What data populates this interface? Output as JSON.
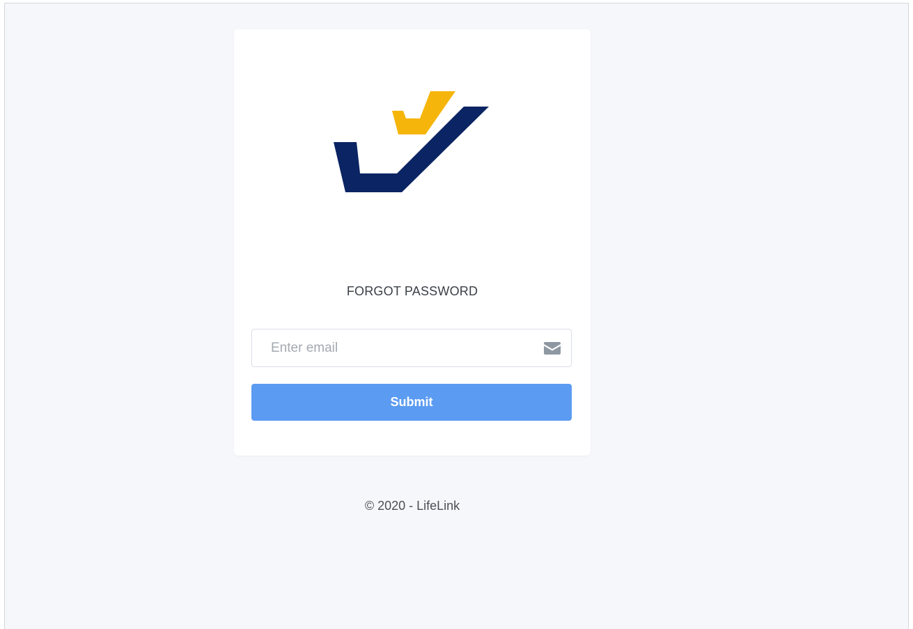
{
  "brand": {
    "logo_icon": "checkmark-logo-icon",
    "colors": {
      "navy": "#0b2463",
      "gold": "#f5b50a"
    }
  },
  "form": {
    "title": "FORGOT PASSWORD",
    "email_placeholder": "Enter email",
    "email_value": "",
    "email_icon": "envelope-icon",
    "submit_label": "Submit",
    "submit_color": "#5b9bf2"
  },
  "footer": {
    "copyright": "© 2020 - LifeLink"
  }
}
